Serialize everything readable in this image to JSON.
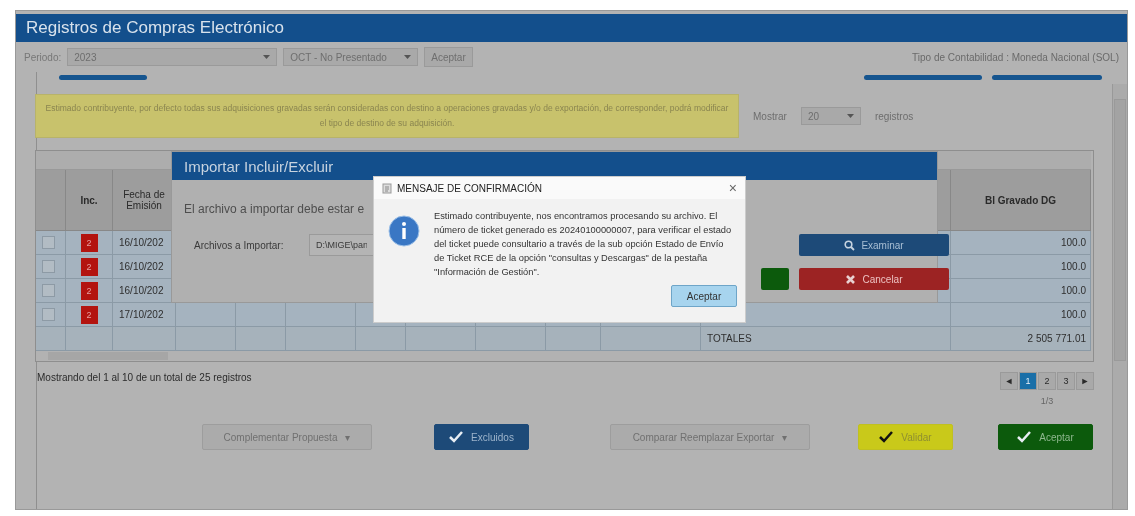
{
  "window": {
    "title": "Registros de Compras Electrónico"
  },
  "filters": {
    "period_label": "Periodo:",
    "year": "2023",
    "month": "OCT - No Presentado",
    "apply": "Aceptar",
    "accounting_type": "Tipo de Contabilidad : Moneda Nacional (SOL)"
  },
  "notice": {
    "text": "Estimado contribuyente, por defecto todas sus adquisiciones gravadas serán consideradas con destino a operaciones gravadas y/o de exportación, de corresponder, podrá modificar el tipo de destino de su adquisición."
  },
  "page_size": {
    "label": "Mostrar",
    "value": "20",
    "suffix": "registros"
  },
  "table": {
    "columns": [
      "Inc.",
      "Fecha de Emisión",
      "Bl Gravado DG"
    ],
    "rows": [
      {
        "checked": false,
        "inc": "2",
        "date": "16/10/202",
        "amount": "100.0"
      },
      {
        "checked": false,
        "inc": "2",
        "date": "16/10/202",
        "amount": "100.0"
      },
      {
        "checked": false,
        "inc": "2",
        "date": "16/10/202",
        "amount": "100.0"
      },
      {
        "checked": false,
        "inc": "2",
        "date": "17/10/202",
        "amount": "100.0"
      }
    ],
    "totals": {
      "label": "TOTALES",
      "amount": "2 505 771.01"
    }
  },
  "summary": "Mostrando del 1 al 10 de un total de 25 registros",
  "pager": {
    "prev": "◄",
    "pages": [
      {
        "label": "1",
        "selected": true
      },
      {
        "label": "2",
        "selected": false
      },
      {
        "label": "3",
        "selected": false
      }
    ],
    "next": "►",
    "position": "1/3"
  },
  "actions": [
    {
      "kind": "dropdown",
      "label": "Complementar Propuesta",
      "caret": "▾"
    },
    {
      "kind": "primary",
      "label": "Excluidos"
    },
    {
      "kind": "dropdown",
      "label": "Comparar Reemplazar Exportar",
      "caret": "▾"
    },
    {
      "kind": "warning",
      "label": "Validar"
    },
    {
      "kind": "success",
      "label": "Aceptar"
    }
  ],
  "import_dialog": {
    "title": "Importar Incluir/Excluir",
    "instruction": "El archivo a importar debe estar e",
    "file_label": "Archivos a Importar:",
    "file_value": "D:\\MIGE\\pan",
    "browse": "Examinar",
    "cancel": "Cancelar"
  },
  "message_box": {
    "title": "MENSAJE DE CONFIRMACIÓN",
    "close": "×",
    "text": "Estimado contribuyente, nos encontramos procesando su archivo. El número de ticket generado es 20240100000007, para verificar el estado del ticket puede consultario a través de la sub opción Estado de Envío de Ticket RCE de la opción \"consultas y Descargas\" de la pestaña \"Información de Gestión\".",
    "ok": "Aceptar"
  }
}
